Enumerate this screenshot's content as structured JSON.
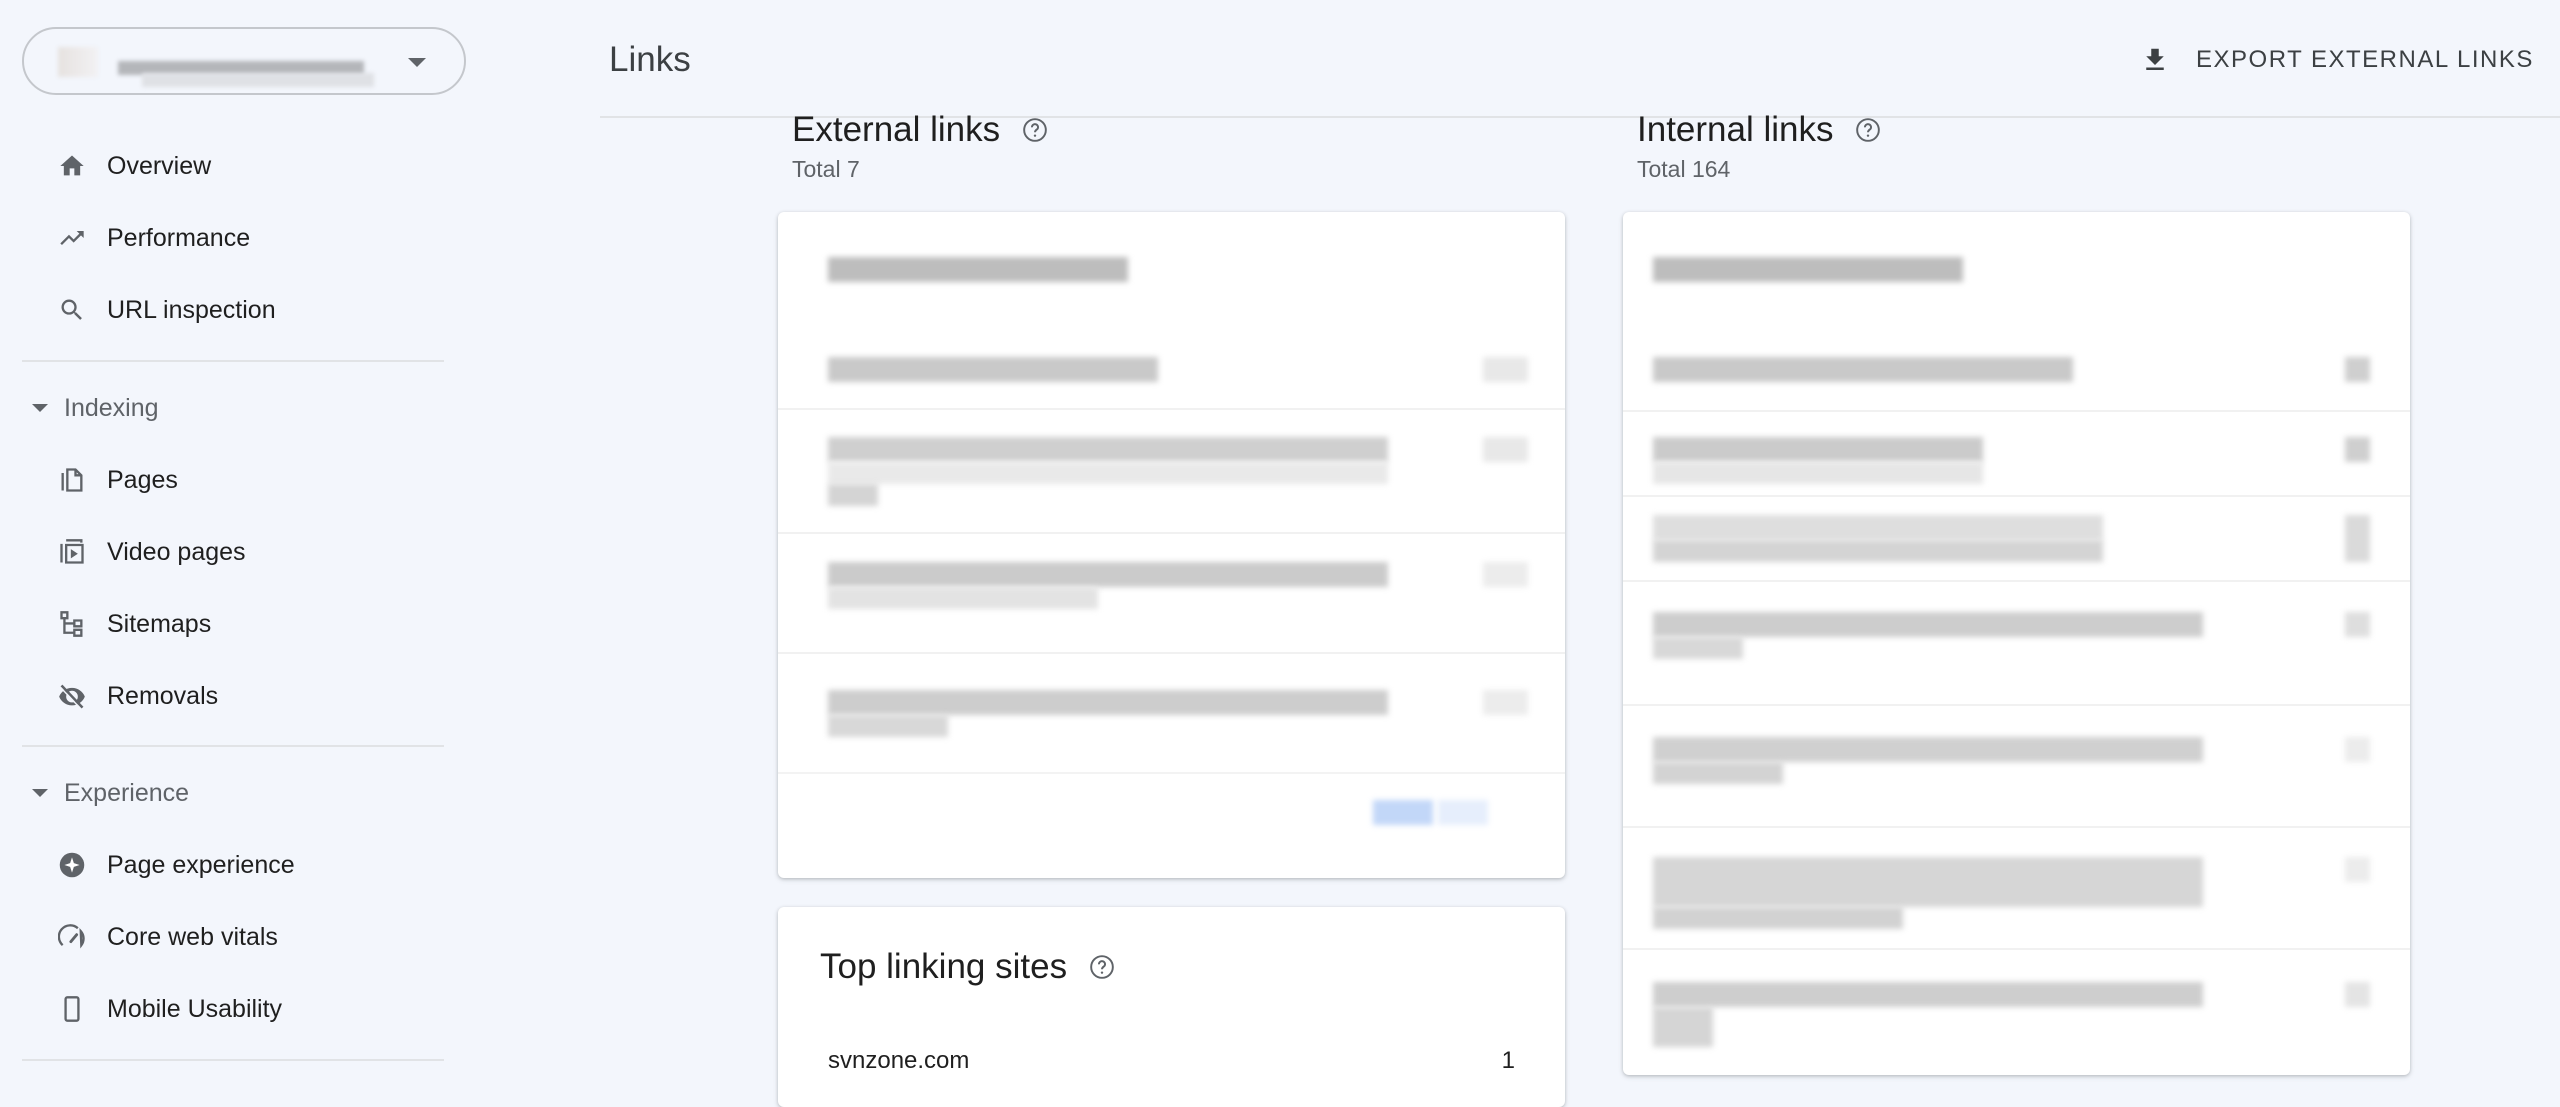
{
  "sidebar": {
    "property_selector": {
      "value": "[redacted property]"
    },
    "items_top": [
      {
        "label": "Overview",
        "icon": "home-icon"
      },
      {
        "label": "Performance",
        "icon": "trending-up-icon"
      },
      {
        "label": "URL inspection",
        "icon": "search-icon"
      }
    ],
    "sections": [
      {
        "label": "Indexing",
        "items": [
          {
            "label": "Pages",
            "icon": "pages-icon"
          },
          {
            "label": "Video pages",
            "icon": "video-pages-icon"
          },
          {
            "label": "Sitemaps",
            "icon": "sitemap-icon"
          },
          {
            "label": "Removals",
            "icon": "visibility-off-icon"
          }
        ]
      },
      {
        "label": "Experience",
        "items": [
          {
            "label": "Page experience",
            "icon": "page-experience-icon"
          },
          {
            "label": "Core web vitals",
            "icon": "speedometer-icon"
          },
          {
            "label": "Mobile Usability",
            "icon": "smartphone-icon"
          }
        ]
      }
    ]
  },
  "header": {
    "title": "Links",
    "export_label": "EXPORT EXTERNAL LINKS"
  },
  "external": {
    "title": "External links",
    "total": "Total 7",
    "content": "[pixelated / obscured table]"
  },
  "internal": {
    "title": "Internal links",
    "total": "Total 164",
    "content": "[pixelated / obscured table]"
  },
  "top_linking_sites": {
    "title": "Top linking sites",
    "rows": [
      {
        "site": "svnzone.com",
        "count": "1"
      }
    ]
  },
  "colors": {
    "background": "#f3f6fc",
    "text_primary": "#1f1f1f",
    "text_secondary": "#5f6368",
    "icon": "#5f6368",
    "accent_blurred": "#c2d7f8"
  }
}
